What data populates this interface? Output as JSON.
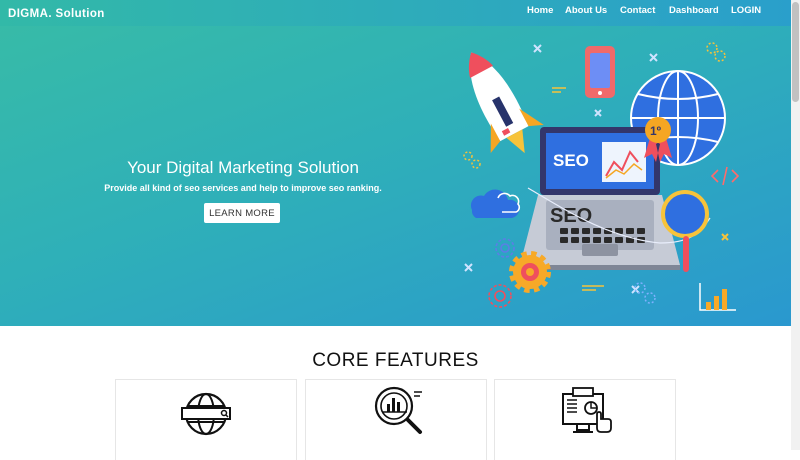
{
  "navbar": {
    "brand": "DIGMA. Solution",
    "links": [
      "Home",
      "About Us",
      "Contact",
      "Dashboard",
      "LOGIN"
    ]
  },
  "hero": {
    "title": "Your Digital Marketing Solution",
    "subtitle": "Provide all kind of seo services and help to improve seo ranking.",
    "cta_label": "LEARN MORE",
    "illustration": {
      "screen_text": "SEO",
      "laptop_label": "SEO",
      "badge_text": "1º"
    }
  },
  "features": {
    "title": "CORE FEATURES",
    "cards": [
      {
        "icon": "globe-search-icon"
      },
      {
        "icon": "magnifier-analytics-icon"
      },
      {
        "icon": "dashboard-touch-icon"
      }
    ]
  },
  "colors": {
    "hero_start": "#38bca6",
    "hero_end": "#2a98cf",
    "accent_orange": "#f7a928",
    "accent_blue": "#2f6fe0"
  }
}
